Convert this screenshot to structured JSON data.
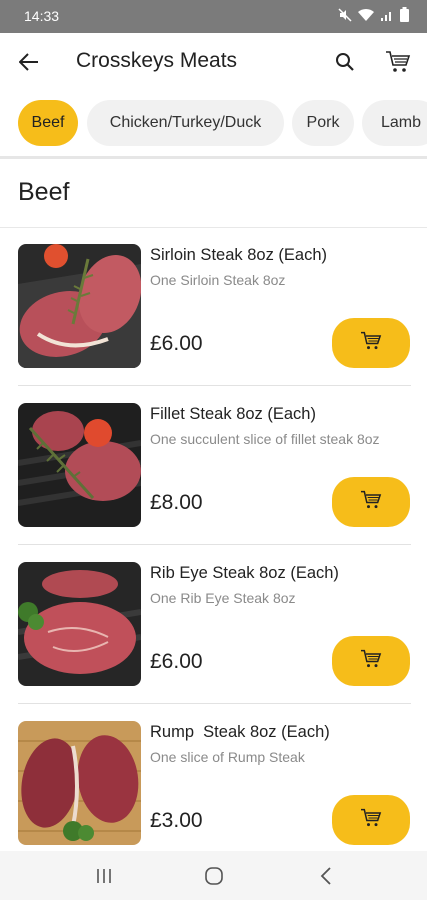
{
  "status_bar": {
    "time": "14:33",
    "icons": [
      "mute-icon",
      "wifi-icon",
      "signal-icon",
      "battery-icon"
    ]
  },
  "app_bar": {
    "title": "Crosskeys Meats",
    "icons": [
      "back-arrow-icon",
      "search-icon",
      "cart-icon"
    ]
  },
  "categories": [
    {
      "label": "Beef",
      "active": true
    },
    {
      "label": "Chicken/Turkey/Duck",
      "active": false
    },
    {
      "label": "Pork",
      "active": false
    },
    {
      "label": "Lamb",
      "active": false
    }
  ],
  "section": {
    "title": "Beef"
  },
  "products": [
    {
      "name": "Sirloin Steak 8oz (Each)",
      "description": "One Sirloin Steak 8oz",
      "price": "£6.00"
    },
    {
      "name": "Fillet Steak 8oz (Each)",
      "description": "One succulent slice of fillet steak 8oz",
      "price": "£8.00"
    },
    {
      "name": "Rib Eye Steak 8oz (Each)",
      "description": "One Rib Eye Steak 8oz",
      "price": "£6.00"
    },
    {
      "name": "Rump  Steak 8oz (Each)",
      "description": "One slice of Rump Steak",
      "price": "£3.00"
    }
  ],
  "colors": {
    "accent": "#f6bd1a",
    "status_bar": "#7b7b7b",
    "chip_bg": "#f1f1f1"
  },
  "nav_bar": {
    "icons": [
      "recent-apps-icon",
      "home-icon",
      "back-icon"
    ]
  }
}
